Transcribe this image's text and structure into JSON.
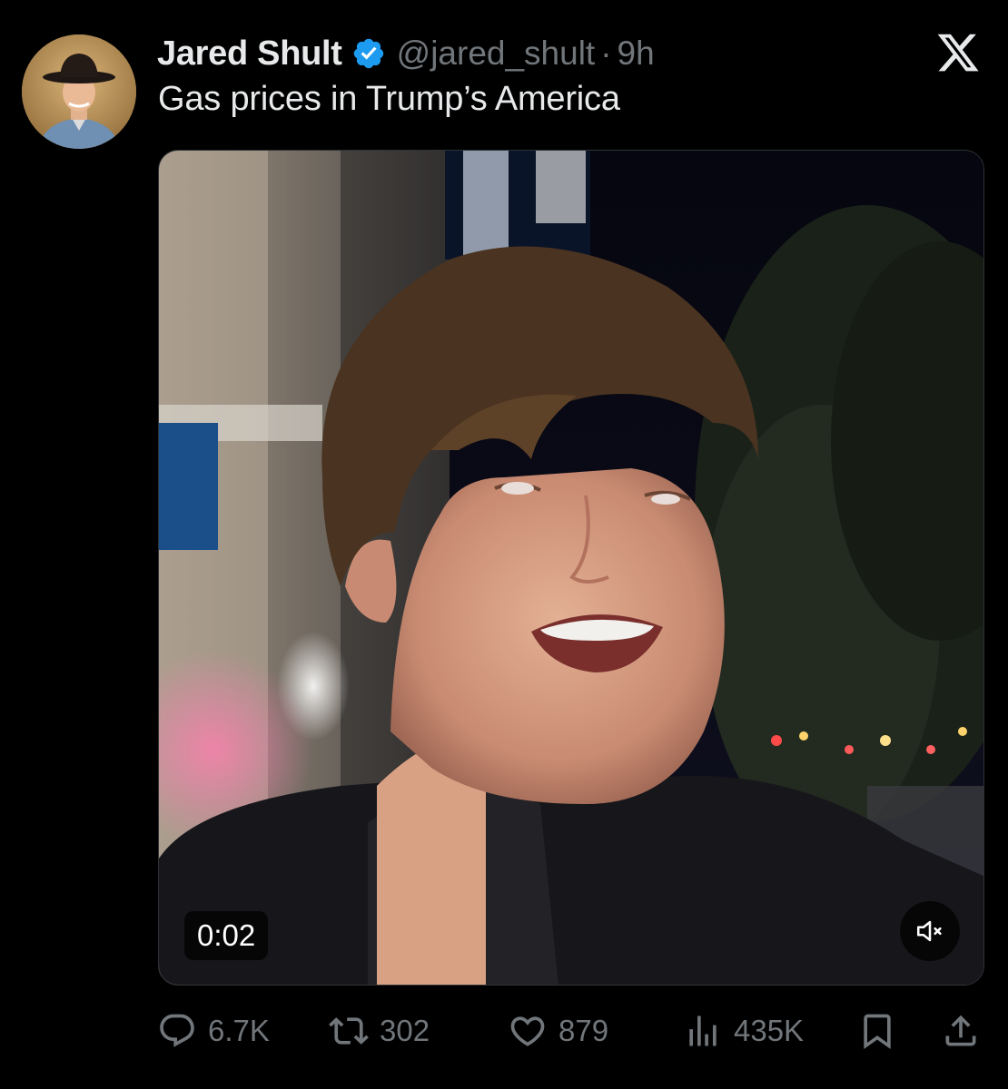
{
  "author": {
    "name": "Jared Shult",
    "handle": "@jared_shult",
    "separator": "·",
    "time": "9h",
    "verified": true
  },
  "tweet": {
    "text": "Gas prices in Trump’s America"
  },
  "video": {
    "timestamp": "0:02",
    "muted": true
  },
  "metrics": {
    "replies": "6.7K",
    "reposts": "302",
    "likes": "879",
    "views": "435K"
  },
  "icons": {
    "brand": "x-logo-icon",
    "verified": "verified-badge-icon",
    "reply": "reply-icon",
    "repost": "repost-icon",
    "like": "heart-icon",
    "views": "views-icon",
    "bookmark": "bookmark-icon",
    "share": "share-icon",
    "mute": "muted-speaker-icon"
  },
  "colors": {
    "background": "#000000",
    "text_primary": "#e7e9ea",
    "text_secondary": "#71767b",
    "verified_blue": "#1d9bf0"
  }
}
